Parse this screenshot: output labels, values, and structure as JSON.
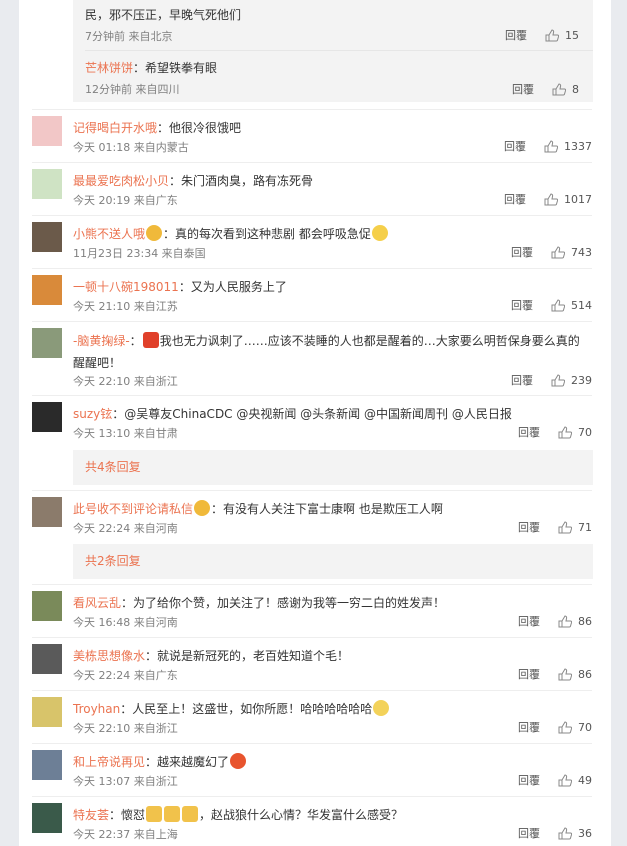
{
  "subs": [
    {
      "text": "民，邪不压正，早晚气死他们",
      "time": "7分钟前 来自北京",
      "reply": "回覆",
      "likes": "15"
    },
    {
      "name": "芒林饼饼",
      "sep": "：",
      "text": "希望铁拳有眼",
      "time": "12分钟前 来自四川",
      "reply": "回覆",
      "likes": "8"
    }
  ],
  "comments": [
    {
      "name": "记得喝白开水哦",
      "sep": "：",
      "text": "他很冷很饿吧",
      "time": "今天 01:18 来自内蒙古",
      "reply": "回覆",
      "likes": "1337"
    },
    {
      "name": "最最爱吃肉松小贝",
      "sep": "：",
      "text": "朱门酒肉臭，路有冻死骨",
      "time": "今天 20:19 来自广东",
      "reply": "回覆",
      "likes": "1017"
    },
    {
      "name": "小熊不送人哦",
      "sep": "：",
      "text": "真的每次看到这种悲剧 都会呼吸急促",
      "time": "11月23日 23:34 来自泰国",
      "reply": "回覆",
      "likes": "743"
    },
    {
      "name": "一顿十八碗198011",
      "sep": "：",
      "text": "又为人民服务上了",
      "time": "今天 21:10 来自江苏",
      "reply": "回覆",
      "likes": "514"
    },
    {
      "name": "-脑黄掬绿-",
      "sep": "：",
      "text": "我也无力讽刺了……应该不装睡的人也都是醒着的…大家要么明哲保身要么真的醒醒吧！",
      "time": "今天 22:10 来自浙江",
      "reply": "回覆",
      "likes": "239"
    },
    {
      "name": "suzy铉",
      "sep": "：",
      "text": "@吴尊友ChinaCDC @央视新闻 @头条新闻 @中国新闻周刊 @人民日报",
      "time": "今天 13:10 来自甘肃",
      "reply": "回覆",
      "likes": "70"
    },
    {
      "name": "此号收不到评论请私信",
      "sep": "：",
      "text": "有没有人关注下富士康啊 也是欺压工人啊",
      "time": "今天 22:24 来自河南",
      "reply": "回覆",
      "likes": "71"
    },
    {
      "name": "看风云乱",
      "sep": "：",
      "text": "为了给你个赞，加关注了！感谢为我等一穷二白的姓发声！",
      "time": "今天 16:48 来自河南",
      "reply": "回覆",
      "likes": "86"
    },
    {
      "name": "美栋思想像水",
      "sep": "：",
      "text": "就说是新冠死的，老百姓知道个毛！",
      "time": "今天 22:24 来自广东",
      "reply": "回覆",
      "likes": "86"
    },
    {
      "name": "Troyhan",
      "sep": "：",
      "text": "人民至上！这盛世，如你所愿！哈哈哈哈哈哈",
      "time": "今天 22:10 来自浙江",
      "reply": "回覆",
      "likes": "70"
    },
    {
      "name": "和上帝说再见",
      "sep": "：",
      "text": "越来越魔幻了",
      "time": "今天 13:07 来自浙江",
      "reply": "回覆",
      "likes": "49"
    },
    {
      "name": "特友荟",
      "sep": "：",
      "text_a": "懷怼",
      "text_b": "，赵战狼什么心情？华发富什么感受？",
      "time": "今天 22:37 来自上海",
      "reply": "回覆",
      "likes": "36"
    }
  ],
  "more": [
    "共4条回复",
    "共2条回复"
  ],
  "colors": {
    "name": "#eb7350",
    "background": "#e9ebef"
  }
}
